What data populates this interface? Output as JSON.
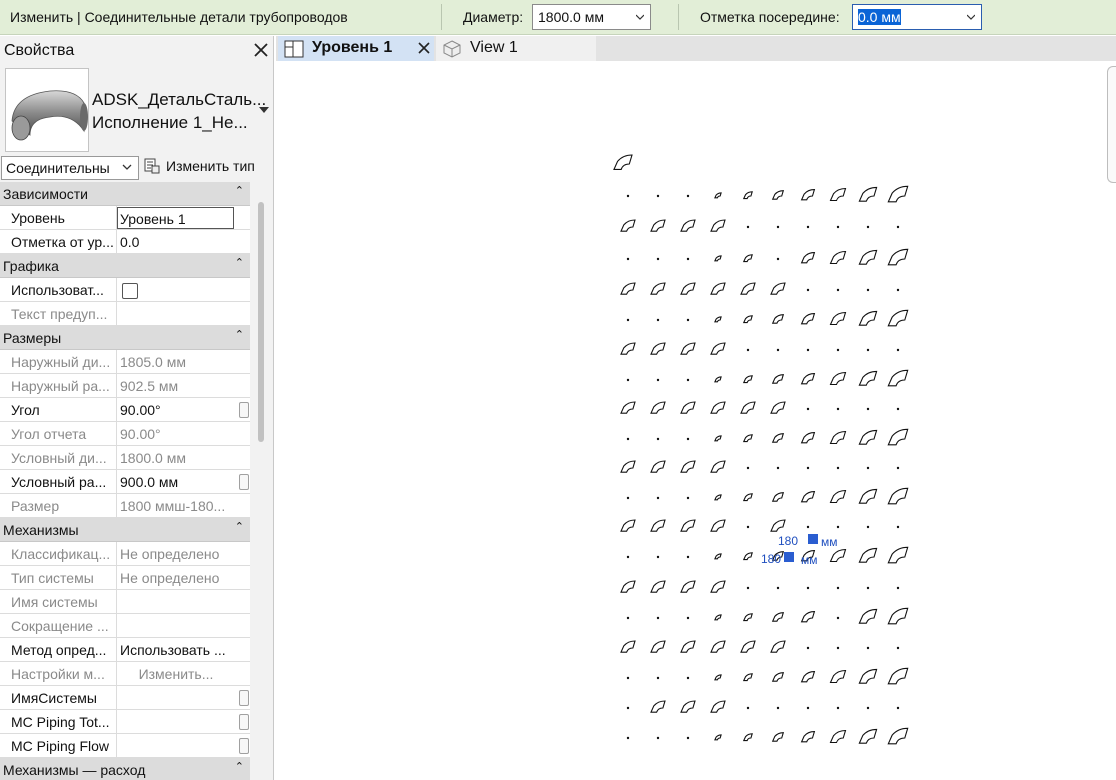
{
  "options_bar": {
    "context": "Изменить | Соединительные детали трубопроводов",
    "diameter_label": "Диаметр:",
    "diameter_value": "1800.0 мм",
    "midpoint_label": "Отметка посередине:",
    "midpoint_value": "0.0 мм"
  },
  "properties": {
    "title": "Свойства",
    "type_name_1": "ADSK_ДетальСталь...",
    "type_name_2": "Исполнение 1_Не...",
    "filter_value": "Соединительны",
    "edit_type_label": "Изменить тип",
    "sections": [
      {
        "title": "Зависимости",
        "rows": [
          {
            "key": "Уровень",
            "value": "Уровень 1"
          },
          {
            "key": "Отметка от ур...",
            "value": "0.0"
          }
        ]
      },
      {
        "title": "Графика",
        "rows": [
          {
            "key": "Использоват...",
            "value": ""
          },
          {
            "key": "Текст предуп...",
            "value": ""
          }
        ]
      },
      {
        "title": "Размеры",
        "rows": [
          {
            "key": "Наружный ди...",
            "value": "1805.0 мм"
          },
          {
            "key": "Наружный ра...",
            "value": "902.5 мм"
          },
          {
            "key": "Угол",
            "value": "90.00°"
          },
          {
            "key": "Угол отчета",
            "value": "90.00°"
          },
          {
            "key": "Условный ди...",
            "value": "1800.0 мм"
          },
          {
            "key": "Условный ра...",
            "value": "900.0 мм"
          },
          {
            "key": "Размер",
            "value": "1800 ммш-180..."
          }
        ]
      },
      {
        "title": "Механизмы",
        "rows": [
          {
            "key": "Классификац...",
            "value": "Не определено"
          },
          {
            "key": "Тип системы",
            "value": "Не определено"
          },
          {
            "key": "Имя системы",
            "value": ""
          },
          {
            "key": "Сокращение ...",
            "value": ""
          },
          {
            "key": "Метод опред...",
            "value": "Использовать ..."
          },
          {
            "key": "Настройки м...",
            "value": "Изменить..."
          },
          {
            "key": "ИмяСистемы",
            "value": ""
          },
          {
            "key": "MC Piping Tot...",
            "value": ""
          },
          {
            "key": "MC Piping Flow",
            "value": ""
          }
        ]
      },
      {
        "title": "Механизмы — расход",
        "rows": []
      }
    ]
  },
  "tabs": [
    {
      "label": "Уровень 1"
    },
    {
      "label": "View 1"
    }
  ],
  "canvas": {
    "dim_label_1": "180",
    "dim_label_2": "мм",
    "dim_label_3": "180",
    "dim_label_4": "мм"
  }
}
